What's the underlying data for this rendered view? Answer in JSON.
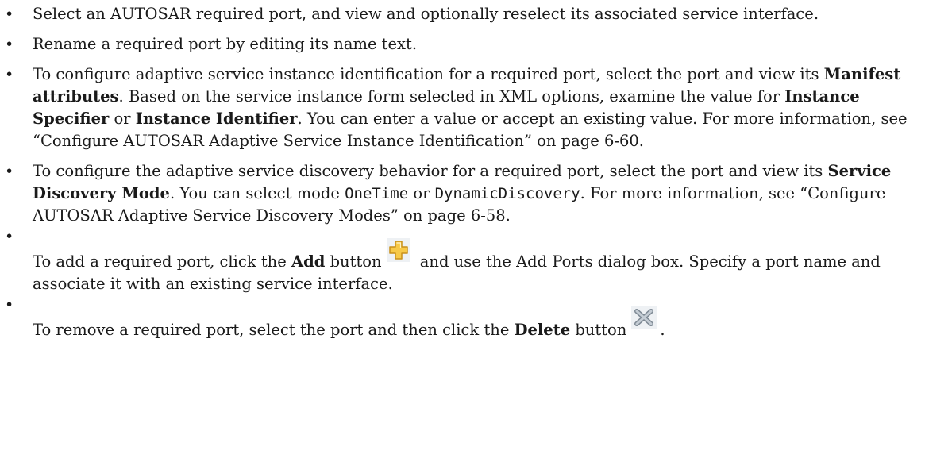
{
  "bullet_glyph": "•",
  "items": {
    "i1": {
      "text": "Select an AUTOSAR required port, and view and optionally reselect its associated service interface."
    },
    "i2": {
      "text": "Rename a required port by editing its name text."
    },
    "i3": {
      "t1": "To configure adaptive service instance identification for a required port, select the port and view its ",
      "b1": "Manifest attributes",
      "t2": ". Based on the service instance form selected in XML options, examine the value for ",
      "b2": "Instance Specifier",
      "t3": " or ",
      "b3": "Instance Identifier",
      "t4": ". You can enter a value or accept an existing value. For more information, see “Configure AUTOSAR Adaptive Service Instance Identification” on page 6-60."
    },
    "i4": {
      "t1": "To configure the adaptive service discovery behavior for a required port, select the port and view its ",
      "b1": "Service Discovery Mode",
      "t2": ". You can select mode ",
      "m1": "OneTime",
      "t3": " or ",
      "m2": "DynamicDiscovery",
      "t4": ". For more information, see “Configure AUTOSAR Adaptive Service Discovery Modes” on page 6-58."
    },
    "i5": {
      "t1": "To add a required port, click the ",
      "b1": "Add",
      "t2": " button",
      "t3": " and use the Add Ports dialog box. Specify a port name and associate it with an existing service interface.",
      "icon": "add-plus-icon"
    },
    "i6": {
      "t1": "To remove a required port, select the port and then click the ",
      "b1": "Delete",
      "t2": " button",
      "t3": ".",
      "icon": "delete-x-icon"
    }
  },
  "colors": {
    "text": "#1a1a1a",
    "add_icon_fill": "#f7c948",
    "add_icon_border": "#c8901a",
    "delete_icon": "#9aa3ad"
  }
}
